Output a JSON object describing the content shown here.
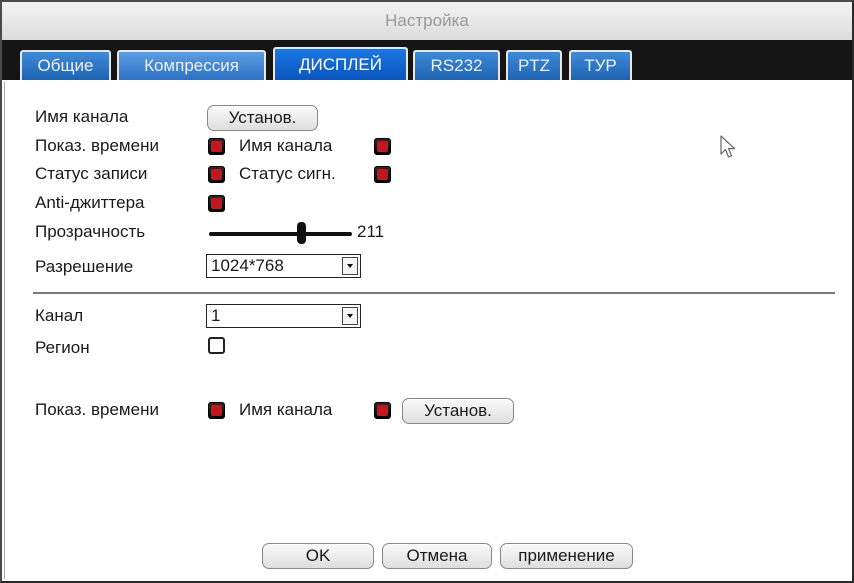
{
  "window": {
    "title": "Настройка"
  },
  "tabs": [
    {
      "label": "Общие"
    },
    {
      "label": "Компрессия"
    },
    {
      "label": "ДИСПЛЕЙ"
    },
    {
      "label": "RS232"
    },
    {
      "label": "PTZ"
    },
    {
      "label": "ТУР"
    }
  ],
  "gui": {
    "channel_name_label": "Имя канала",
    "channel_name_button": "Установ.",
    "show_time_label": "Показ. времени",
    "show_time_checked": true,
    "show_channel_name_label": "Имя канала",
    "show_channel_name_checked": true,
    "record_status_label": "Статус записи",
    "record_status_checked": true,
    "alarm_status_label": "Статус сигн.",
    "alarm_status_checked": true,
    "anti_jitter_label": "Anti-джиттера",
    "anti_jitter_checked": true,
    "transparency_label": "Прозрачность",
    "transparency_value": "211",
    "transparency_min": 128,
    "transparency_max": 255,
    "resolution_label": "Разрешение",
    "resolution_value": "1024*768"
  },
  "channel": {
    "channel_label": "Канал",
    "channel_value": "1",
    "region_label": "Регион",
    "region_checked": false,
    "show_time_label": "Показ. времени",
    "show_time_checked": true,
    "channel_name_label": "Имя канала",
    "channel_name_checked": true,
    "set_button": "Установ."
  },
  "footer": {
    "ok_label": "OK",
    "cancel_label": "Отмена",
    "apply_label": "применение"
  },
  "colors": {
    "tab_blue": "#1e63b2",
    "tab_active": "#0a55be",
    "checkbox_mark": "#c31720"
  }
}
